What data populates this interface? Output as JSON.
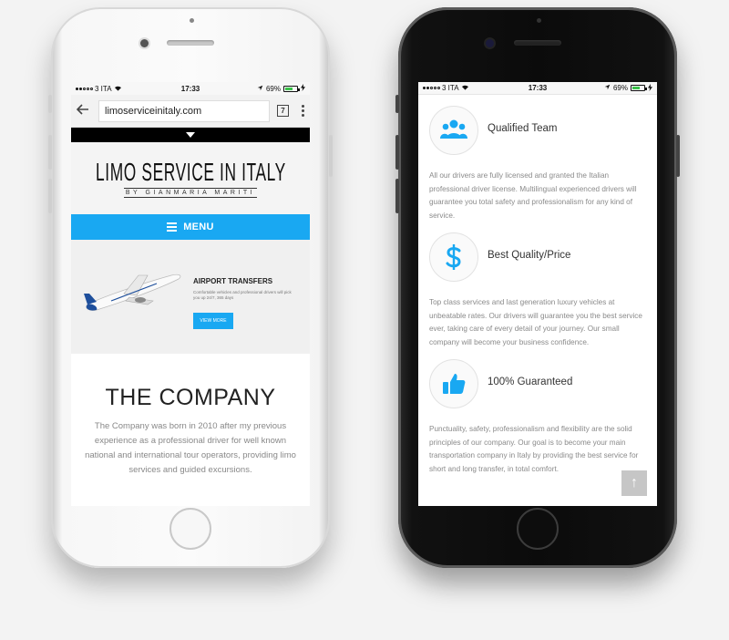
{
  "status_bar": {
    "carrier": "3 ITA",
    "time": "17:33",
    "battery": "69%",
    "battery_level": 0.69
  },
  "left_phone": {
    "browser": {
      "url": "limoserviceinitaly.com",
      "tab_count": "7"
    },
    "site": {
      "logo_title": "LIMO SERVICE IN ITALY",
      "logo_subtitle": "BY GIANMARIA MARITI",
      "menu_label": "MENU",
      "hero": {
        "title": "AIRPORT TRANSFERS",
        "text": "Comfortable vehicles and professional drivers will pick you up 24/7, 365 days",
        "button": "VIEW MORE"
      },
      "company": {
        "heading": "THE COMPANY",
        "text": "The Company was born in 2010 after my previous experience as a professional driver for well known national and international tour operators, providing limo services and guided excursions."
      }
    }
  },
  "right_phone": {
    "features": [
      {
        "icon": "team-icon",
        "title": "Qualified Team",
        "text": "All our drivers are fully licensed and granted the Italian professional driver license. Multilingual experienced drivers will guarantee you total safety and professionalism for any kind of service."
      },
      {
        "icon": "dollar-icon",
        "title": "Best Quality/Price",
        "text": "Top class services and last generation luxury vehicles at unbeatable rates. Our drivers will guarantee you the best service ever, taking care of every detail of your journey. Our small company will become your business confidence."
      },
      {
        "icon": "thumbs-up-icon",
        "title": "100% Guaranteed",
        "text": "Punctuality, safety, professionalism and flexibility are the solid principles of our company. Our goal is to become your main transportation company in Italy by providing the best service for short and long transfer, in total comfort."
      }
    ],
    "back_to_top": "↑"
  },
  "colors": {
    "accent": "#19a8f2",
    "battery_green": "#3ac24a"
  }
}
